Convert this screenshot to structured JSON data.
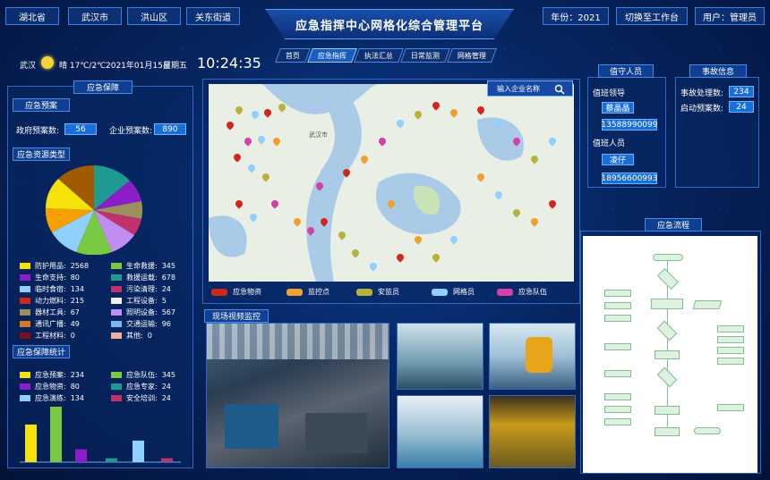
{
  "top_nav": {
    "province": "湖北省",
    "city": "武汉市",
    "district": "洪山区",
    "street": "关东街道"
  },
  "app_title": "应急指挥中心网格化综合管理平台",
  "year": "年份：2021",
  "switch_label": "切换至工作台",
  "user": "用户：管理员",
  "tabs": [
    "首页",
    "应急指挥",
    "执法汇总",
    "日常监测",
    "网格管理"
  ],
  "weather": {
    "city": "武汉",
    "desc": "晴 17℃/2℃",
    "date": "2021年01月15日",
    "weekday": "星期五",
    "time": "10:24:35"
  },
  "left": {
    "section_title": "应急保障",
    "plan": {
      "title": "应急预案",
      "gov_label": "政府预案数:",
      "gov_value": "56",
      "ent_label": "企业预案数:",
      "ent_value": "890"
    },
    "resource": {
      "title": "应急资源类型",
      "items": [
        {
          "label": "防护用品:",
          "value": "2568",
          "color": "#f5e20b"
        },
        {
          "label": "生命救援:",
          "value": "345",
          "color": "#7ac943"
        },
        {
          "label": "生命支持:",
          "value": "80",
          "color": "#8a1fc9"
        },
        {
          "label": "救援运载:",
          "value": "678",
          "color": "#1e9a92"
        },
        {
          "label": "临时食宿:",
          "value": "134",
          "color": "#8fd0ff"
        },
        {
          "label": "污染清理:",
          "value": "24",
          "color": "#c0326b"
        },
        {
          "label": "动力燃料:",
          "value": "215",
          "color": "#d0261e"
        },
        {
          "label": "工程设备:",
          "value": "5",
          "color": "#f0f0f0"
        },
        {
          "label": "器材工具:",
          "value": "67",
          "color": "#9c8f5e"
        },
        {
          "label": "照明设备:",
          "value": "567",
          "color": "#c08ef0"
        },
        {
          "label": "通讯广播:",
          "value": "49",
          "color": "#d47a1c"
        },
        {
          "label": "交通运输:",
          "value": "96",
          "color": "#7ab8f5"
        },
        {
          "label": "工程材料:",
          "value": "0",
          "color": "#7a1020"
        },
        {
          "label": "其他:",
          "value": "0",
          "color": "#e8b4a0"
        }
      ]
    },
    "stats": {
      "title": "应急保障统计",
      "items": [
        {
          "label": "应急预案:",
          "value": "234",
          "color": "#f5e20b"
        },
        {
          "label": "应急队伍:",
          "value": "345",
          "color": "#7ac943"
        },
        {
          "label": "应急物资:",
          "value": "80",
          "color": "#8a1fc9"
        },
        {
          "label": "应急专家:",
          "value": "24",
          "color": "#1e9a92"
        },
        {
          "label": "应急演练:",
          "value": "134",
          "color": "#8fd0ff"
        },
        {
          "label": "安全培训:",
          "value": "24",
          "color": "#c0326b"
        }
      ]
    }
  },
  "map": {
    "search_placeholder": "输入企业名称",
    "legend": [
      {
        "label": "应急物资",
        "color": "#d0261e"
      },
      {
        "label": "监控点",
        "color": "#f0a02c"
      },
      {
        "label": "安监员",
        "color": "#b8b23a"
      },
      {
        "label": "网格员",
        "color": "#8fd0ff"
      },
      {
        "label": "应急队伍",
        "color": "#d53fa8"
      }
    ],
    "place_label": "武汉市"
  },
  "video_title": "现场视频监控",
  "duty": {
    "title": "值守人员",
    "leader_label": "值班领导",
    "leader_name": "蔡晶晶",
    "leader_phone": "13588990099",
    "staff_label": "值班人员",
    "staff_name": "凌仔",
    "staff_phone": "18956600993"
  },
  "accident": {
    "title": "事故信息",
    "handled_label": "事故处理数:",
    "handled_value": "234",
    "plans_label": "启动预案数:",
    "plans_value": "24"
  },
  "flow": {
    "title": "应急流程"
  }
}
